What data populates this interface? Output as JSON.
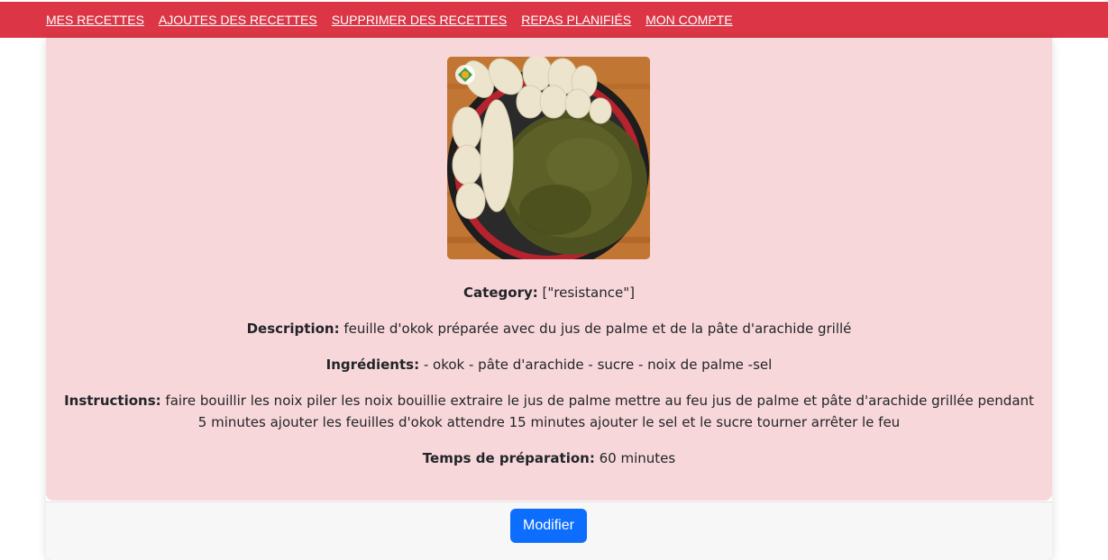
{
  "nav": {
    "items": [
      {
        "label": "MES RECETTES"
      },
      {
        "label": "AJOUTES DES RECETTES"
      },
      {
        "label": "SUPPRIMER DES RECETTES"
      },
      {
        "label": "REPAS PLANIFIÉS"
      },
      {
        "label": "MON COMPTE"
      }
    ]
  },
  "recipe": {
    "category_label": "Category:",
    "category_value": "[\"resistance\"]",
    "description_label": "Description:",
    "description_value": "feuille d'okok préparée avec du jus de palme et de la pâte d'arachide grillé",
    "ingredients_label": "Ingrédients:",
    "ingredients_value": "- okok - pâte d'arachide - sucre - noix de palme -sel",
    "instructions_label": "Instructions:",
    "instructions_value": "faire bouillir les noix piler les noix bouillie extraire le jus de palme mettre au feu jus de palme et pâte d'arachide grillée pendant 5 minutes ajouter les feuilles d'okok attendre 15 minutes ajouter le sel et le sucre tourner arrêter le feu",
    "time_label": "Temps de préparation:",
    "time_value": "60 minutes"
  },
  "footer": {
    "edit_label": "Modifier"
  },
  "colors": {
    "navbar": "#dc3545",
    "card_body": "#f8d7da",
    "button": "#0d6efd"
  }
}
